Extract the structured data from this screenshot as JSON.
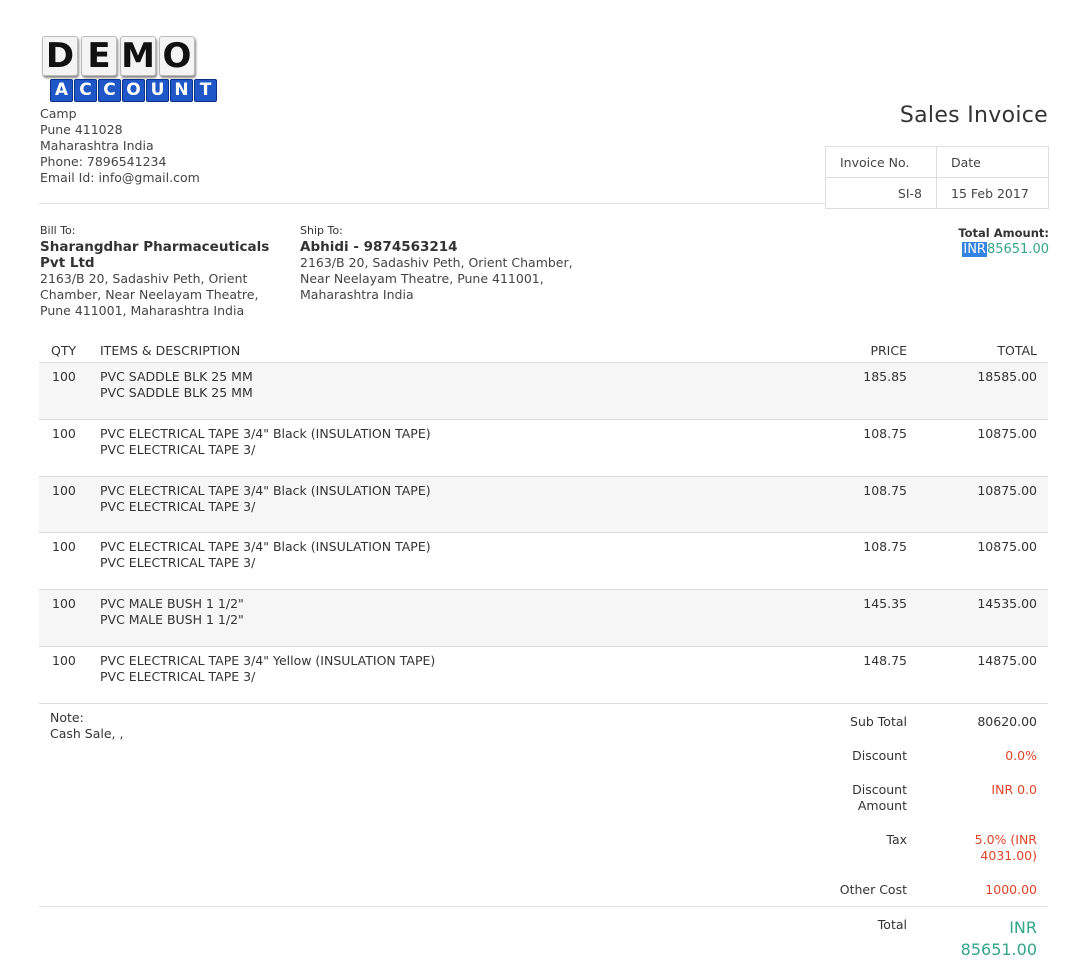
{
  "logo": {
    "line1": "DEMO",
    "line2": "ACCOUNT"
  },
  "company": {
    "address_lines": [
      "Camp",
      "Pune 411028",
      "Maharashtra India",
      "Phone: 7896541234",
      "Email Id: info@gmail.com"
    ]
  },
  "invoice": {
    "title": "Sales Invoice",
    "no_label": "Invoice No.",
    "date_label": "Date",
    "no": "SI-8",
    "date": "15 Feb 2017"
  },
  "bill_to": {
    "label": "Bill To:",
    "name_lines": [
      "Sharangdhar Pharmaceuticals",
      "Pvt Ltd"
    ],
    "address_lines": [
      "2163/B 20, Sadashiv Peth, Orient",
      "Chamber, Near Neelayam Theatre,",
      "Pune 411001, Maharashtra India"
    ]
  },
  "ship_to": {
    "label": "Ship To:",
    "name": "Abhidi - 9874563214",
    "address_lines": [
      "2163/B 20, Sadashiv Peth, Orient Chamber,",
      "Near Neelayam Theatre, Pune 411001,",
      "Maharashtra India"
    ]
  },
  "total_amount": {
    "label": "Total Amount:",
    "currency": "INR",
    "value": "85651.00"
  },
  "table": {
    "headers": {
      "qty": "QTY",
      "items": "ITEMS & DESCRIPTION",
      "price": "PRICE",
      "total": "TOTAL"
    },
    "rows": [
      {
        "qty": "100",
        "item": "PVC SADDLE BLK 25 MM",
        "desc": "PVC SADDLE BLK 25 MM",
        "price": "185.85",
        "total": "18585.00"
      },
      {
        "qty": "100",
        "item": "PVC ELECTRICAL TAPE 3/4\" Black (INSULATION TAPE)",
        "desc": "PVC ELECTRICAL TAPE 3/",
        "price": "108.75",
        "total": "10875.00"
      },
      {
        "qty": "100",
        "item": "PVC ELECTRICAL TAPE 3/4\" Black (INSULATION TAPE)",
        "desc": "PVC ELECTRICAL TAPE 3/",
        "price": "108.75",
        "total": "10875.00"
      },
      {
        "qty": "100",
        "item": "PVC ELECTRICAL TAPE 3/4\" Black (INSULATION TAPE)",
        "desc": "PVC ELECTRICAL TAPE 3/",
        "price": "108.75",
        "total": "10875.00"
      },
      {
        "qty": "100",
        "item": "PVC MALE BUSH 1 1/2\"",
        "desc": "PVC MALE BUSH 1 1/2\"",
        "price": "145.35",
        "total": "14535.00"
      },
      {
        "qty": "100",
        "item": "PVC ELECTRICAL TAPE 3/4\" Yellow (INSULATION TAPE)",
        "desc": "PVC ELECTRICAL TAPE 3/",
        "price": "148.75",
        "total": "14875.00"
      }
    ]
  },
  "note": {
    "label": "Note:",
    "text": "Cash Sale, ,"
  },
  "summary": {
    "subtotal_label": "Sub Total",
    "subtotal": "80620.00",
    "discount_label": "Discount",
    "discount": "0.0%",
    "discount_amount_label_1": "Discount",
    "discount_amount_label_2": "Amount",
    "discount_amount": "INR 0.0",
    "tax_label": "Tax",
    "tax_1": "5.0% (INR",
    "tax_2": "4031.00)",
    "other_cost_label": "Other Cost",
    "other_cost": "1000.00",
    "total_label": "Total",
    "total_currency": "INR",
    "total": "85651.00"
  },
  "colors": {
    "accent_teal": "#33a58b",
    "value_red": "#e0452a",
    "logo_blue": "#1f56c8"
  }
}
